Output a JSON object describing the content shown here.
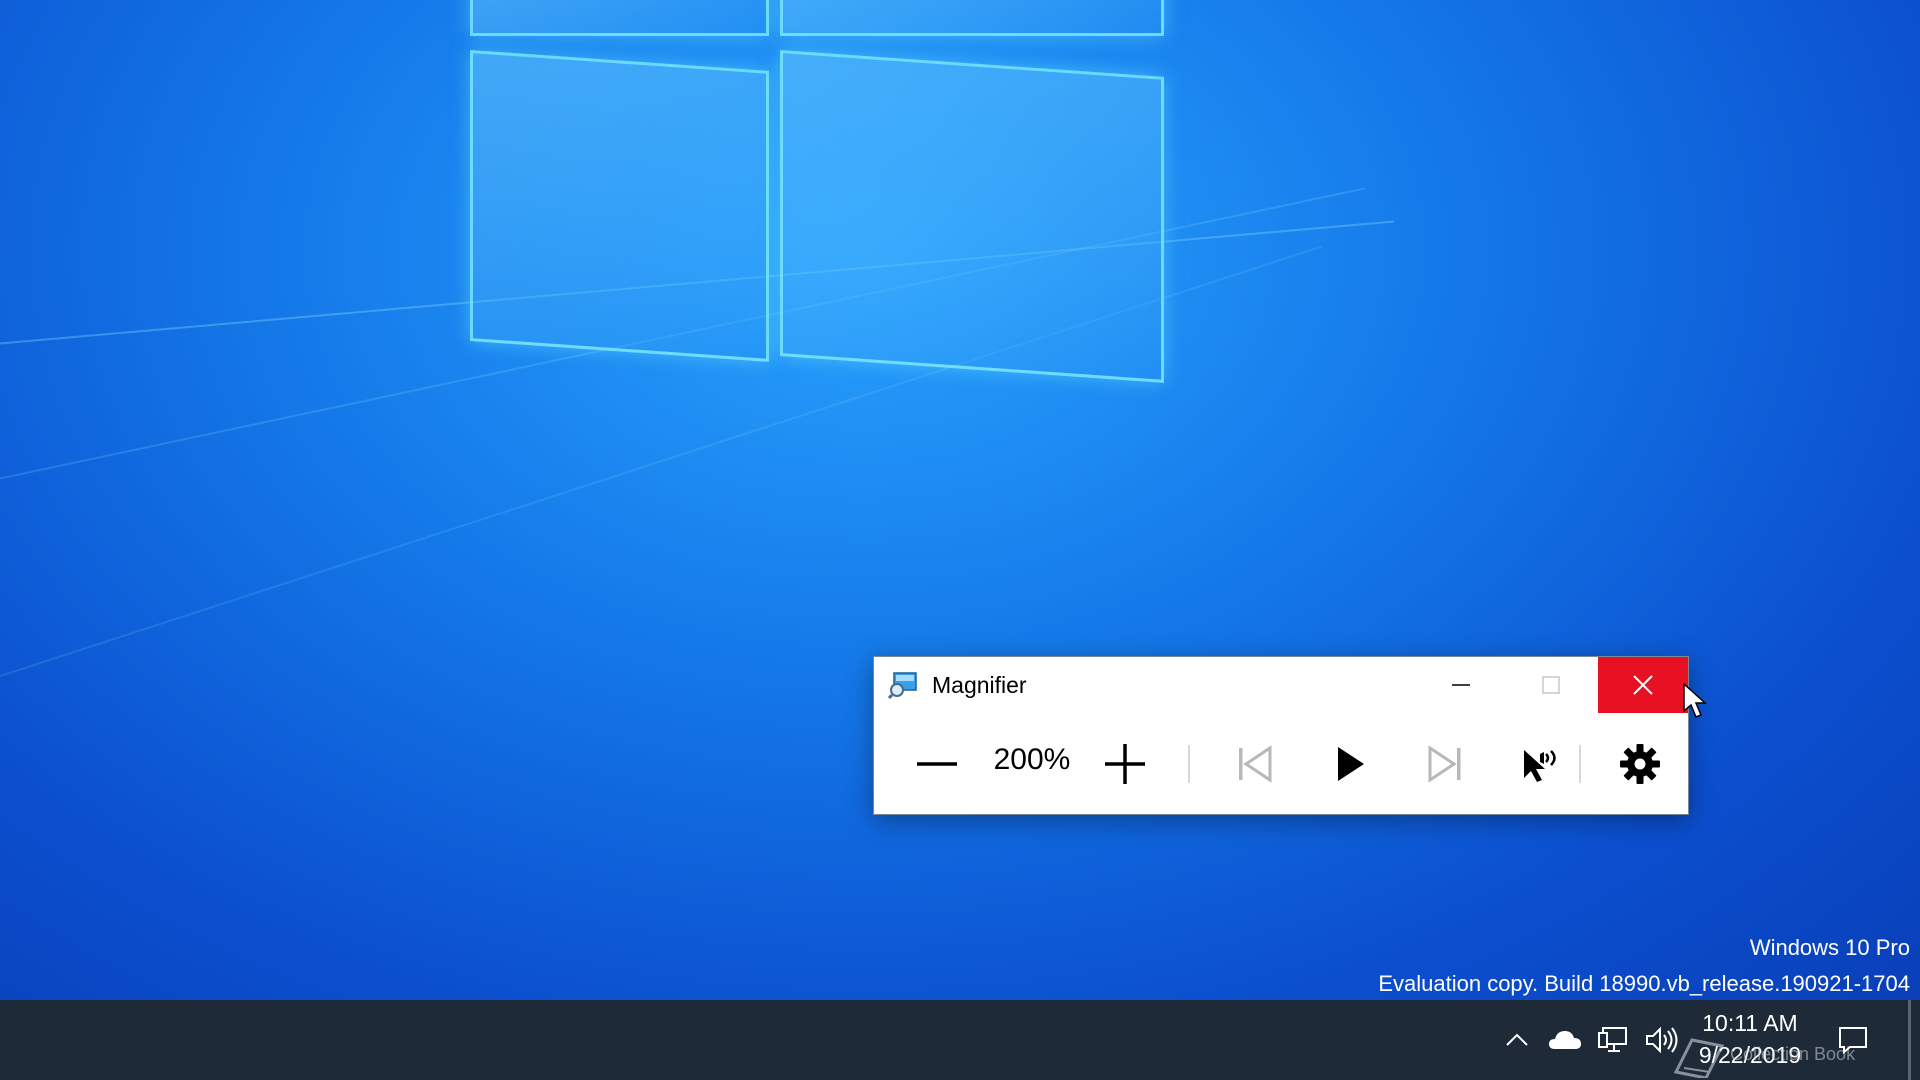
{
  "desktop": {
    "watermark_line1": "Windows 10 Pro",
    "watermark_line2": "Evaluation copy. Build 18990.vb_release.190921-1704"
  },
  "magnifier": {
    "title": "Magnifier",
    "zoom_level": "200%",
    "app_icon": "magnifier-icon",
    "caption_buttons": {
      "minimize_icon": "minimize-icon",
      "maximize_icon": "maximize-icon",
      "close_icon": "close-icon",
      "close_hover_color": "#e81123"
    },
    "toolbar": {
      "zoom_out_icon": "minus-icon",
      "zoom_in_icon": "plus-icon",
      "previous_icon": "skip-previous-icon",
      "play_icon": "play-icon",
      "next_icon": "skip-next-icon",
      "read_from_here_icon": "read-from-here-icon",
      "settings_icon": "gear-icon"
    }
  },
  "taskbar": {
    "background": "#1f2a38",
    "tray_icons": [
      "chevron-up-icon",
      "onedrive-cloud-icon",
      "network-icon",
      "volume-icon"
    ],
    "clock_time": "10:11 AM",
    "clock_date": "9/22/2019",
    "notification_icon": "action-center-icon",
    "watermark_stamp": "Collection Book"
  },
  "colors": {
    "desktop_accent": "#1478e8",
    "close_red": "#e81123"
  }
}
